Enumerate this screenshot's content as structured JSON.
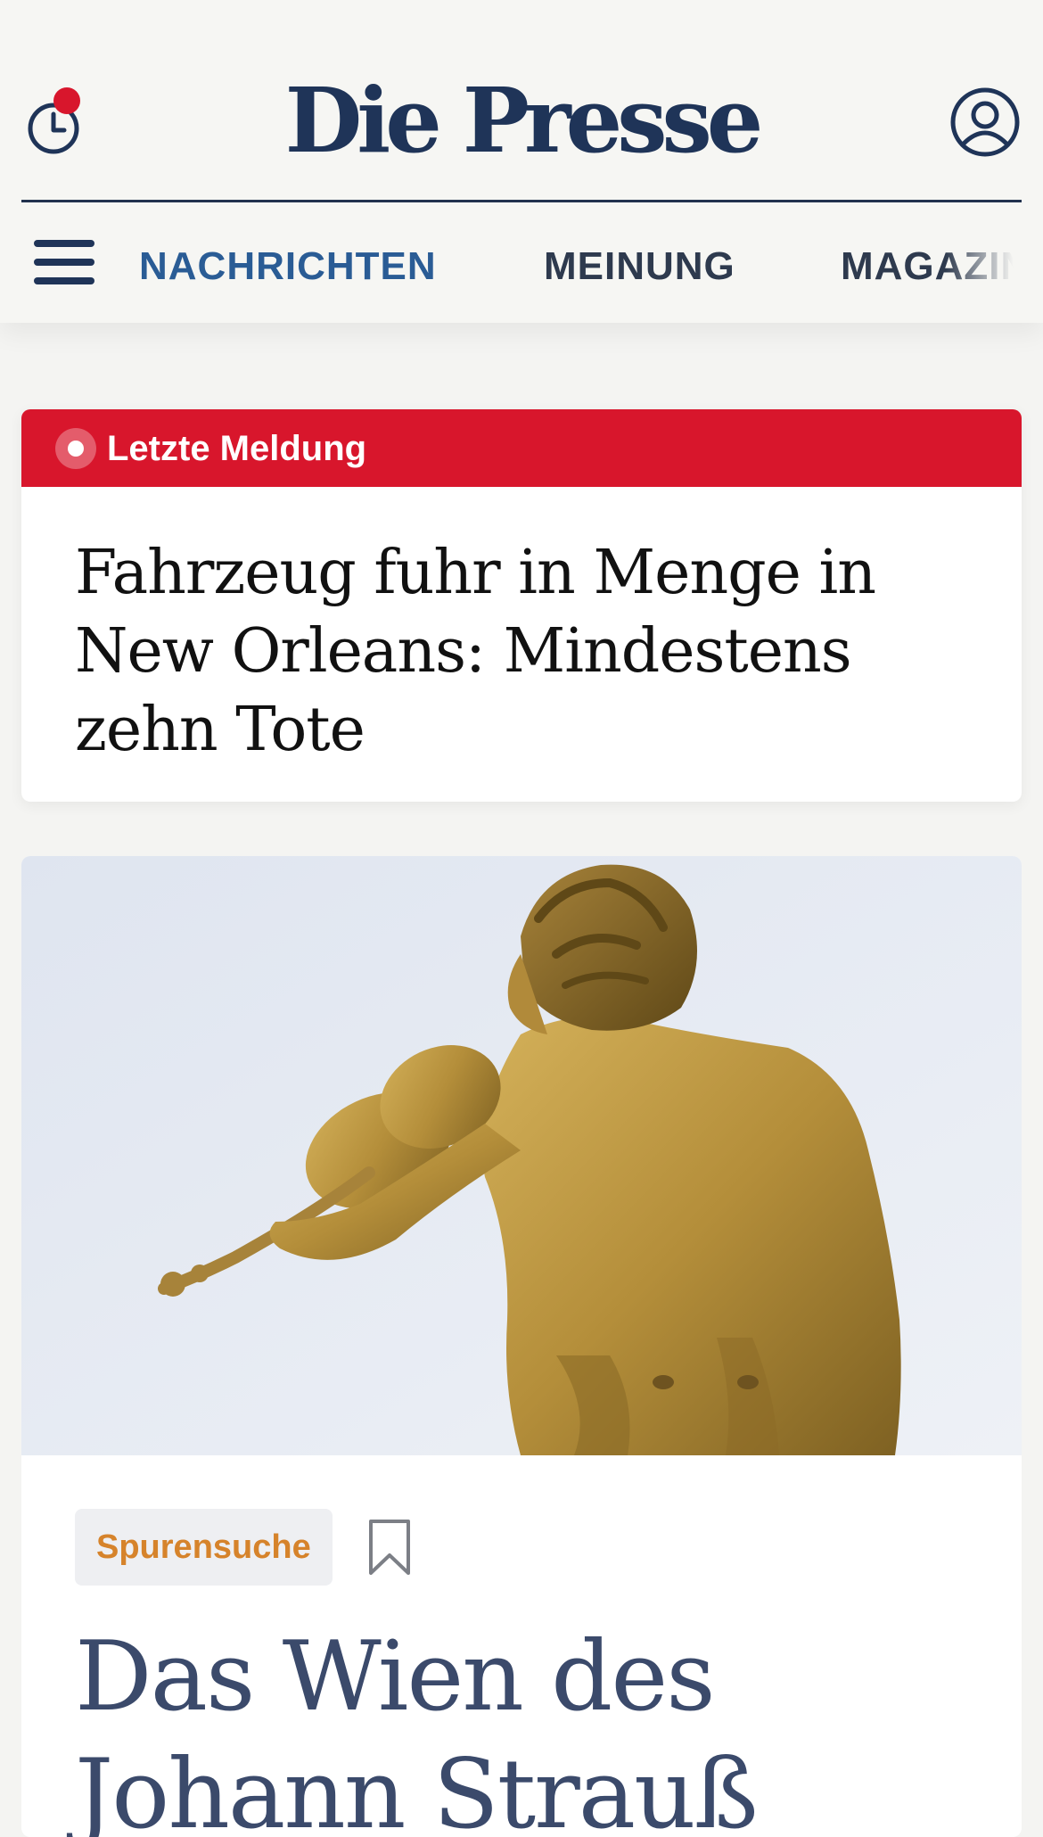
{
  "header": {
    "logo": "Die Presse",
    "nav": [
      {
        "label": "NACHRICHTEN",
        "active": true
      },
      {
        "label": "MEINUNG",
        "active": false
      },
      {
        "label": "MAGAZIN",
        "active": false
      }
    ],
    "notification_color": "#d8162c",
    "brand_color": "#1f3458",
    "icons": [
      "history-clock-icon",
      "account-icon",
      "hamburger-menu-icon"
    ]
  },
  "breaking": {
    "label": "Letzte Meldung",
    "headline": "Fahrzeug fuhr in Menge in New Orleans: Mindestens zehn Tote",
    "color": "#d8162c"
  },
  "feature": {
    "image": "golden-statue-violinist",
    "tag": "Spurensuche",
    "title": "Das Wien des Johann Strauß",
    "icons": [
      "bookmark-icon"
    ]
  }
}
